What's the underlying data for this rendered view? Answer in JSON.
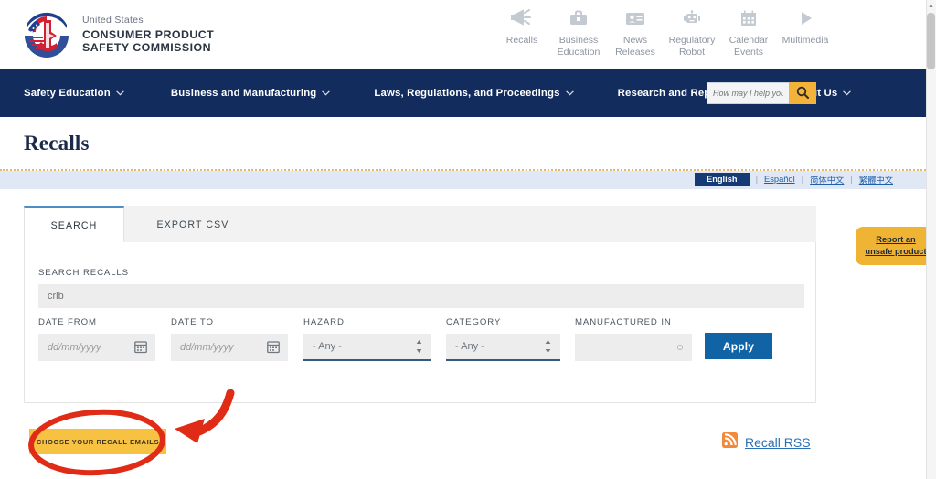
{
  "brand": {
    "line_small": "United States",
    "line1": "CONSUMER PRODUCT",
    "line2": "SAFETY COMMISSION",
    "logo_icon": "cpsc-seal-icon"
  },
  "utility_nav": [
    {
      "label_line1": "Recalls",
      "label_line2": "",
      "icon": "megaphone-icon"
    },
    {
      "label_line1": "Business",
      "label_line2": "Education",
      "icon": "briefcase-icon"
    },
    {
      "label_line1": "News",
      "label_line2": "Releases",
      "icon": "id-card-icon"
    },
    {
      "label_line1": "Regulatory",
      "label_line2": "Robot",
      "icon": "robot-icon"
    },
    {
      "label_line1": "Calendar",
      "label_line2": "Events",
      "icon": "calendar-icon"
    },
    {
      "label_line1": "Multimedia",
      "label_line2": "",
      "icon": "play-icon"
    }
  ],
  "main_nav": {
    "items": [
      {
        "label": "Safety Education"
      },
      {
        "label": "Business and Manufacturing"
      },
      {
        "label": "Laws, Regulations, and Proceedings"
      },
      {
        "label": "Research and Reports"
      },
      {
        "label": "About Us"
      }
    ],
    "chevron_icon": "chevron-down-icon",
    "search": {
      "placeholder": "How may I help you?",
      "value": "",
      "button_icon": "search-icon"
    }
  },
  "page": {
    "title": "Recalls"
  },
  "language_bar": {
    "active": "English",
    "options": [
      "Español",
      "简体中文",
      "繁體中文"
    ],
    "separator": "|"
  },
  "tabs": [
    {
      "label": "SEARCH",
      "active": true
    },
    {
      "label": "EXPORT CSV",
      "active": false
    }
  ],
  "form": {
    "search_recalls": {
      "label": "SEARCH RECALLS",
      "value": "crib",
      "placeholder": "crib"
    },
    "date_from": {
      "label": "DATE FROM",
      "value": "",
      "placeholder": "dd/mm/yyyy",
      "icon": "calendar-icon"
    },
    "date_to": {
      "label": "DATE TO",
      "value": "",
      "placeholder": "dd/mm/yyyy",
      "icon": "calendar-icon"
    },
    "hazard": {
      "label": "HAZARD",
      "value": "- Any -",
      "options": [
        "- Any -"
      ]
    },
    "category": {
      "label": "CATEGORY",
      "value": "- Any -",
      "options": [
        "- Any -"
      ]
    },
    "manufactured_in": {
      "label": "MANUFACTURED IN",
      "value": "",
      "placeholder": ""
    },
    "apply_label": "Apply"
  },
  "report_tab": {
    "line1": "Report an",
    "line2": "unsafe product"
  },
  "bottom": {
    "emails_button": "CHOOSE YOUR RECALL EMAILS",
    "rss_label": "Recall RSS",
    "rss_icon": "rss-icon"
  },
  "annotations": {
    "ellipse": "red-ellipse-highlight",
    "arrow": "red-arrow-pointer"
  },
  "colors": {
    "nav_blue": "#122c5e",
    "accent_yellow": "#f2b338",
    "apply_blue": "#1064a5",
    "link_blue": "#2c6fb5",
    "annotation_red": "#e02b16",
    "langbar_blue": "#dfe8f4",
    "tab_active_border": "#4f8ec4"
  },
  "scrollbar": {
    "up_arrow": "▲"
  }
}
